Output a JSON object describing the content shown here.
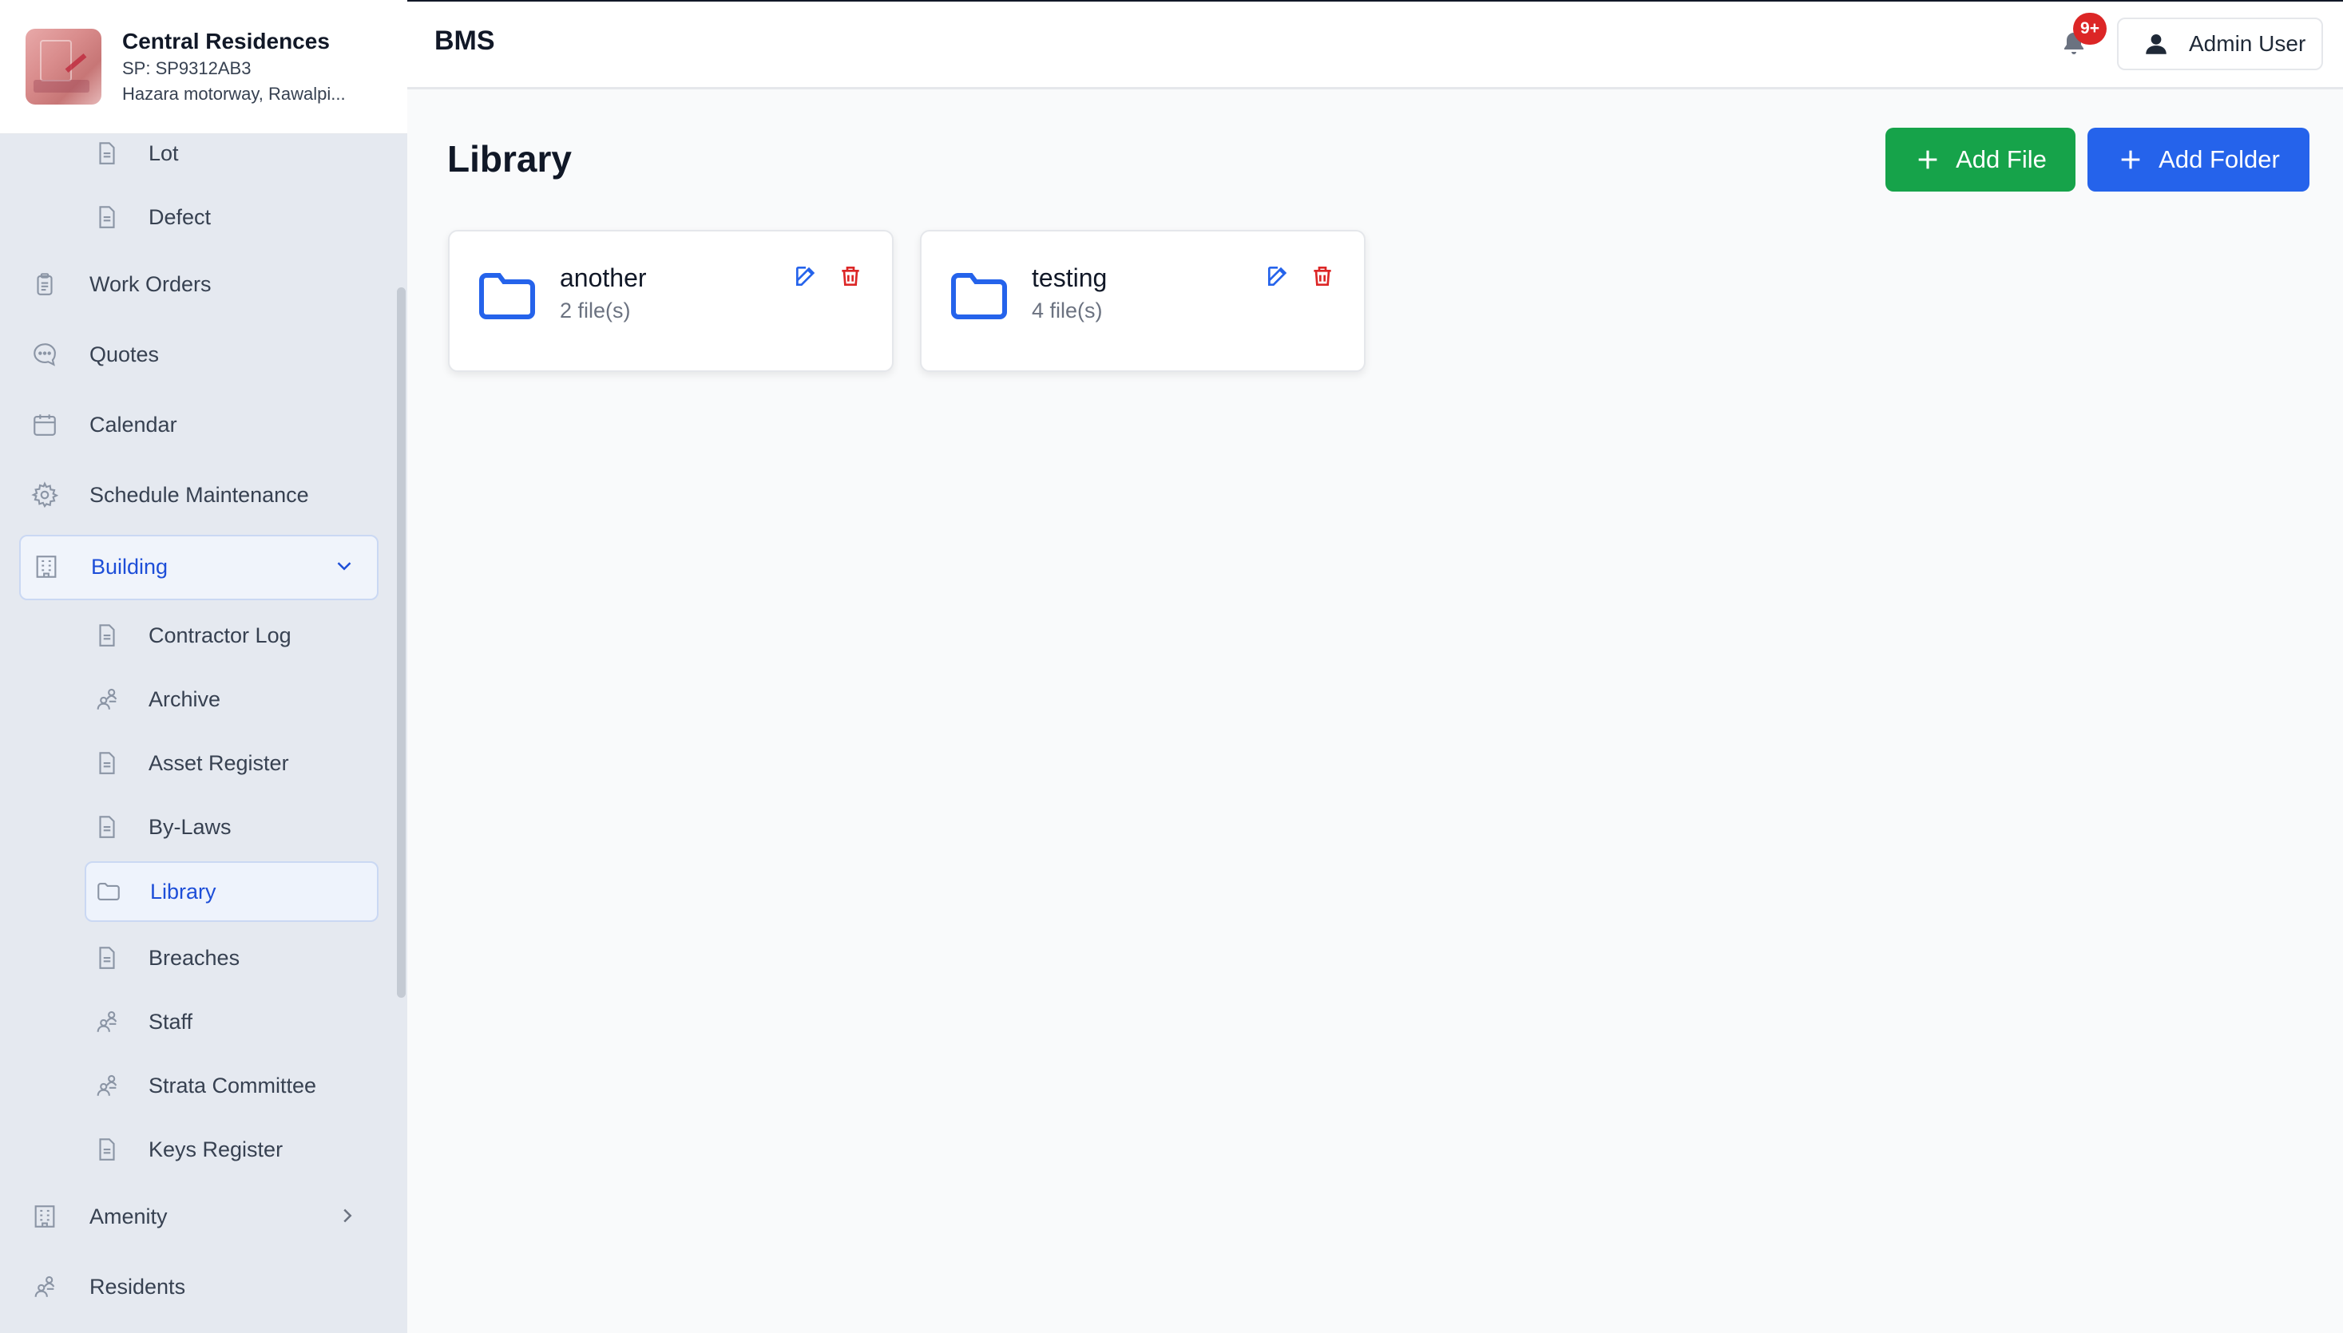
{
  "brand": {
    "name": "Central Residences",
    "sp": "SP: SP9312AB3",
    "address": "Hazara motorway, Rawalpi..."
  },
  "header": {
    "app_title": "BMS",
    "notification_badge": "9+",
    "user_name": "Admin User"
  },
  "sidebar": {
    "items": [
      {
        "label": "Lot",
        "icon": "document-icon"
      },
      {
        "label": "Defect",
        "icon": "document-icon"
      },
      {
        "label": "Work Orders",
        "icon": "clipboard-icon"
      },
      {
        "label": "Quotes",
        "icon": "chat-icon"
      },
      {
        "label": "Calendar",
        "icon": "calendar-icon"
      },
      {
        "label": "Schedule Maintenance",
        "icon": "gear-icon"
      },
      {
        "label": "Building",
        "icon": "building-icon"
      },
      {
        "label": "Contractor Log",
        "icon": "document-icon"
      },
      {
        "label": "Archive",
        "icon": "people-icon"
      },
      {
        "label": "Asset Register",
        "icon": "document-icon"
      },
      {
        "label": "By-Laws",
        "icon": "document-icon"
      },
      {
        "label": "Library",
        "icon": "folder-icon"
      },
      {
        "label": "Breaches",
        "icon": "document-icon"
      },
      {
        "label": "Staff",
        "icon": "people-icon"
      },
      {
        "label": "Strata Committee",
        "icon": "people-icon"
      },
      {
        "label": "Keys Register",
        "icon": "document-icon"
      },
      {
        "label": "Amenity",
        "icon": "building-icon"
      },
      {
        "label": "Residents",
        "icon": "people-icon"
      }
    ]
  },
  "main": {
    "title": "Library",
    "add_file_label": "Add File",
    "add_folder_label": "Add Folder",
    "folders": [
      {
        "name": "another",
        "count": "2 file(s)"
      },
      {
        "name": "testing",
        "count": "4 file(s)"
      }
    ]
  },
  "colors": {
    "accent": "#2563eb",
    "success": "#16a34a",
    "danger": "#dc2626",
    "active_text": "#1d4ed8"
  }
}
